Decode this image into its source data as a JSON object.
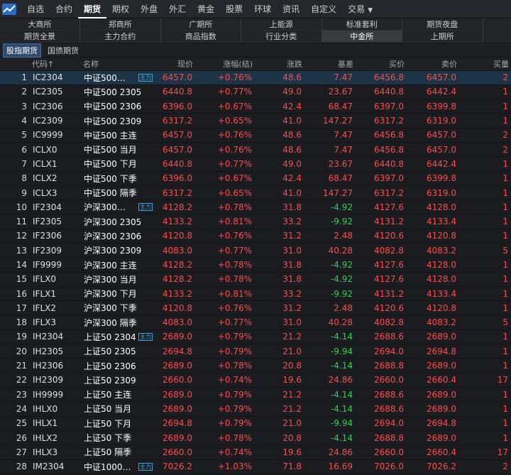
{
  "nav": {
    "items": [
      "自选",
      "合约",
      "期货",
      "期权",
      "外盘",
      "外汇",
      "黄金",
      "股票",
      "环球",
      "资讯",
      "自定义",
      "交易"
    ],
    "active": "期货"
  },
  "exchanges": {
    "row1": [
      "大商所",
      "郑商所",
      "广期所",
      "上能源",
      "标准套利",
      "期货夜盘"
    ],
    "row2": [
      "期货全景",
      "主力合约",
      "商品指数",
      "行业分类",
      "中金所",
      "上期所"
    ],
    "active": "中金所"
  },
  "subtabs": [
    "股指期货",
    "国债期货"
  ],
  "subtab_active": "股指期货",
  "columns": [
    "代码↑",
    "名称",
    "现价",
    "涨幅(结)",
    "涨跌",
    "基差",
    "买价",
    "卖价",
    "买量"
  ],
  "badge_text": "主力",
  "rows": [
    {
      "idx": "1",
      "code": "IC2304",
      "name": "中证500…",
      "badge": true,
      "price": "6457.0",
      "pct": "+0.76%",
      "chg": "48.6",
      "basis": "7.47",
      "bid": "6456.8",
      "ask": "6457.0",
      "vol": "2",
      "basis_dir": "up"
    },
    {
      "idx": "2",
      "code": "IC2305",
      "name": "中证500 2305",
      "badge": false,
      "price": "6440.8",
      "pct": "+0.77%",
      "chg": "49.0",
      "basis": "23.67",
      "bid": "6440.8",
      "ask": "6442.4",
      "vol": "1",
      "basis_dir": "up"
    },
    {
      "idx": "3",
      "code": "IC2306",
      "name": "中证500 2306",
      "badge": false,
      "price": "6396.0",
      "pct": "+0.67%",
      "chg": "42.4",
      "basis": "68.47",
      "bid": "6397.0",
      "ask": "6399.8",
      "vol": "1",
      "basis_dir": "up"
    },
    {
      "idx": "4",
      "code": "IC2309",
      "name": "中证500 2309",
      "badge": false,
      "price": "6317.2",
      "pct": "+0.65%",
      "chg": "41.0",
      "basis": "147.27",
      "bid": "6317.2",
      "ask": "6319.0",
      "vol": "1",
      "basis_dir": "up"
    },
    {
      "idx": "5",
      "code": "IC9999",
      "name": "中证500 主连",
      "badge": false,
      "price": "6457.0",
      "pct": "+0.76%",
      "chg": "48.6",
      "basis": "7.47",
      "bid": "6456.8",
      "ask": "6457.0",
      "vol": "2",
      "basis_dir": "up"
    },
    {
      "idx": "6",
      "code": "ICLX0",
      "name": "中证500 当月",
      "badge": false,
      "price": "6457.0",
      "pct": "+0.76%",
      "chg": "48.6",
      "basis": "7.47",
      "bid": "6456.8",
      "ask": "6457.0",
      "vol": "2",
      "basis_dir": "up"
    },
    {
      "idx": "7",
      "code": "ICLX1",
      "name": "中证500 下月",
      "badge": false,
      "price": "6440.8",
      "pct": "+0.77%",
      "chg": "49.0",
      "basis": "23.67",
      "bid": "6440.8",
      "ask": "6442.4",
      "vol": "1",
      "basis_dir": "up"
    },
    {
      "idx": "8",
      "code": "ICLX2",
      "name": "中证500 下季",
      "badge": false,
      "price": "6396.0",
      "pct": "+0.67%",
      "chg": "42.4",
      "basis": "68.47",
      "bid": "6397.0",
      "ask": "6399.8",
      "vol": "1",
      "basis_dir": "up"
    },
    {
      "idx": "9",
      "code": "ICLX3",
      "name": "中证500 隔季",
      "badge": false,
      "price": "6317.2",
      "pct": "+0.65%",
      "chg": "41.0",
      "basis": "147.27",
      "bid": "6317.2",
      "ask": "6319.0",
      "vol": "1",
      "basis_dir": "up"
    },
    {
      "idx": "10",
      "code": "IF2304",
      "name": "沪深300…",
      "badge": true,
      "price": "4128.2",
      "pct": "+0.78%",
      "chg": "31.8",
      "basis": "-4.92",
      "bid": "4127.6",
      "ask": "4128.0",
      "vol": "1",
      "basis_dir": "down"
    },
    {
      "idx": "11",
      "code": "IF2305",
      "name": "沪深300 2305",
      "badge": false,
      "price": "4133.2",
      "pct": "+0.81%",
      "chg": "33.2",
      "basis": "-9.92",
      "bid": "4131.2",
      "ask": "4133.4",
      "vol": "1",
      "basis_dir": "down"
    },
    {
      "idx": "12",
      "code": "IF2306",
      "name": "沪深300 2306",
      "badge": false,
      "price": "4120.8",
      "pct": "+0.76%",
      "chg": "31.2",
      "basis": "2.48",
      "bid": "4120.6",
      "ask": "4120.8",
      "vol": "1",
      "basis_dir": "up"
    },
    {
      "idx": "13",
      "code": "IF2309",
      "name": "沪深300 2309",
      "badge": false,
      "price": "4083.0",
      "pct": "+0.77%",
      "chg": "31.0",
      "basis": "40.28",
      "bid": "4082.8",
      "ask": "4083.2",
      "vol": "5",
      "basis_dir": "up"
    },
    {
      "idx": "14",
      "code": "IF9999",
      "name": "沪深300 主连",
      "badge": false,
      "price": "4128.2",
      "pct": "+0.78%",
      "chg": "31.8",
      "basis": "-4.92",
      "bid": "4127.6",
      "ask": "4128.0",
      "vol": "1",
      "basis_dir": "down"
    },
    {
      "idx": "15",
      "code": "IFLX0",
      "name": "沪深300 当月",
      "badge": false,
      "price": "4128.2",
      "pct": "+0.78%",
      "chg": "31.8",
      "basis": "-4.92",
      "bid": "4127.6",
      "ask": "4128.0",
      "vol": "1",
      "basis_dir": "down"
    },
    {
      "idx": "16",
      "code": "IFLX1",
      "name": "沪深300 下月",
      "badge": false,
      "price": "4133.2",
      "pct": "+0.81%",
      "chg": "33.2",
      "basis": "-9.92",
      "bid": "4131.2",
      "ask": "4133.4",
      "vol": "1",
      "basis_dir": "down"
    },
    {
      "idx": "17",
      "code": "IFLX2",
      "name": "沪深300 下季",
      "badge": false,
      "price": "4120.8",
      "pct": "+0.76%",
      "chg": "31.2",
      "basis": "2.48",
      "bid": "4120.6",
      "ask": "4120.8",
      "vol": "1",
      "basis_dir": "up"
    },
    {
      "idx": "18",
      "code": "IFLX3",
      "name": "沪深300 隔季",
      "badge": false,
      "price": "4083.0",
      "pct": "+0.77%",
      "chg": "31.0",
      "basis": "40.28",
      "bid": "4082.8",
      "ask": "4083.2",
      "vol": "5",
      "basis_dir": "up"
    },
    {
      "idx": "19",
      "code": "IH2304",
      "name": "上证50 2304",
      "badge": true,
      "price": "2689.0",
      "pct": "+0.79%",
      "chg": "21.2",
      "basis": "-4.14",
      "bid": "2688.6",
      "ask": "2689.0",
      "vol": "1",
      "basis_dir": "down"
    },
    {
      "idx": "20",
      "code": "IH2305",
      "name": "上证50 2305",
      "badge": false,
      "price": "2694.8",
      "pct": "+0.79%",
      "chg": "21.0",
      "basis": "-9.94",
      "bid": "2694.0",
      "ask": "2694.8",
      "vol": "1",
      "basis_dir": "down"
    },
    {
      "idx": "21",
      "code": "IH2306",
      "name": "上证50 2306",
      "badge": false,
      "price": "2689.0",
      "pct": "+0.78%",
      "chg": "20.8",
      "basis": "-4.14",
      "bid": "2688.8",
      "ask": "2689.0",
      "vol": "1",
      "basis_dir": "down"
    },
    {
      "idx": "22",
      "code": "IH2309",
      "name": "上证50 2309",
      "badge": false,
      "price": "2660.0",
      "pct": "+0.74%",
      "chg": "19.6",
      "basis": "24.86",
      "bid": "2660.0",
      "ask": "2660.4",
      "vol": "17",
      "basis_dir": "up"
    },
    {
      "idx": "23",
      "code": "IH9999",
      "name": "上证50 主连",
      "badge": false,
      "price": "2689.0",
      "pct": "+0.79%",
      "chg": "21.2",
      "basis": "-4.14",
      "bid": "2688.6",
      "ask": "2689.0",
      "vol": "1",
      "basis_dir": "down"
    },
    {
      "idx": "24",
      "code": "IHLX0",
      "name": "上证50 当月",
      "badge": false,
      "price": "2689.0",
      "pct": "+0.79%",
      "chg": "21.2",
      "basis": "-4.14",
      "bid": "2688.6",
      "ask": "2689.0",
      "vol": "1",
      "basis_dir": "down"
    },
    {
      "idx": "25",
      "code": "IHLX1",
      "name": "上证50 下月",
      "badge": false,
      "price": "2694.8",
      "pct": "+0.79%",
      "chg": "21.0",
      "basis": "-9.94",
      "bid": "2694.0",
      "ask": "2694.8",
      "vol": "1",
      "basis_dir": "down"
    },
    {
      "idx": "26",
      "code": "IHLX2",
      "name": "上证50 下季",
      "badge": false,
      "price": "2689.0",
      "pct": "+0.78%",
      "chg": "20.8",
      "basis": "-4.14",
      "bid": "2688.8",
      "ask": "2689.0",
      "vol": "1",
      "basis_dir": "down"
    },
    {
      "idx": "27",
      "code": "IHLX3",
      "name": "上证50 隔季",
      "badge": false,
      "price": "2660.0",
      "pct": "+0.74%",
      "chg": "19.6",
      "basis": "24.86",
      "bid": "2660.0",
      "ask": "2660.4",
      "vol": "17",
      "basis_dir": "up"
    },
    {
      "idx": "28",
      "code": "IM2304",
      "name": "中证1000…",
      "badge": true,
      "price": "7026.2",
      "pct": "+1.03%",
      "chg": "71.8",
      "basis": "16.69",
      "bid": "7026.0",
      "ask": "7026.2",
      "vol": "2",
      "basis_dir": "up"
    }
  ],
  "colors": {
    "up": "#ff4b4b",
    "down": "#22d64a",
    "badge": "#3aa5d8",
    "selected_row": "#1d3346"
  }
}
